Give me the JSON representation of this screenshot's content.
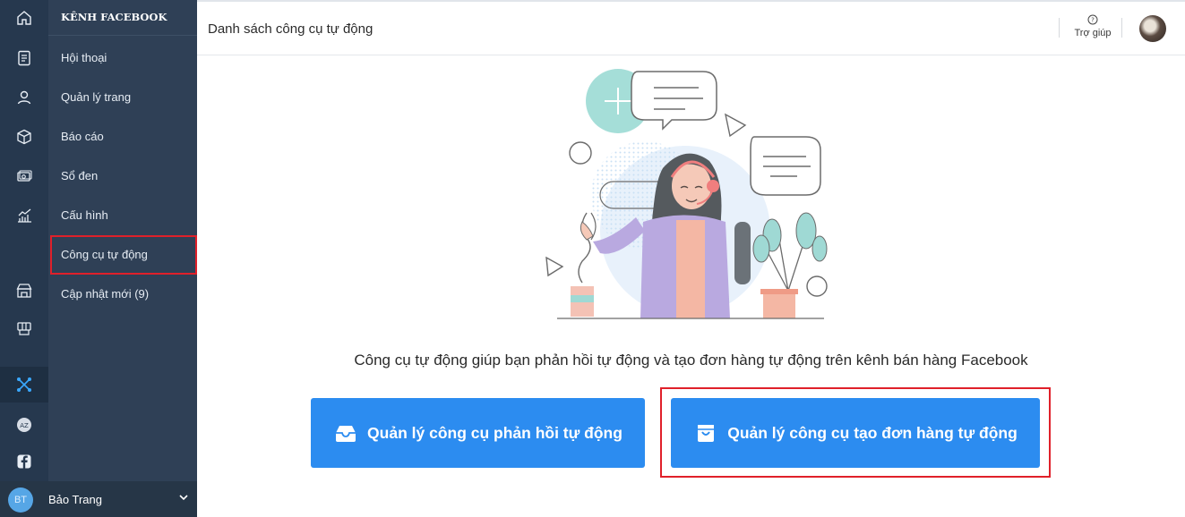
{
  "rail": {
    "icons": [
      "home-icon",
      "document-icon",
      "user-icon",
      "box-icon",
      "cash-icon",
      "chart-icon",
      "store-icon",
      "pos-icon",
      "automation-icon",
      "az-icon",
      "facebook-icon"
    ],
    "active": "automation-icon"
  },
  "menu": {
    "heading": "KÊNH FACEBOOK",
    "items": [
      {
        "label": "Hội thoại"
      },
      {
        "label": "Quản lý trang"
      },
      {
        "label": "Báo cáo"
      },
      {
        "label": "Sổ đen"
      },
      {
        "label": "Cấu hình"
      },
      {
        "label": "Công cụ tự động"
      },
      {
        "label": "Cập nhật mới (9)"
      }
    ],
    "active_item": "Công cụ tự động"
  },
  "user": {
    "initials": "BT",
    "name": "Bảo Trang"
  },
  "header": {
    "title": "Danh sách công cụ tự động",
    "help_label": "Trợ giúp"
  },
  "main": {
    "description": "Công cụ tự động giúp bạn phản hồi tự động và tạo đơn hàng tự động trên kênh bán hàng Facebook",
    "button_reply": "Quản lý công cụ phản hồi tự động",
    "button_order": "Quản lý công cụ tạo đơn hàng tự động"
  },
  "colors": {
    "rail": "#26384e",
    "menu": "#2f4056",
    "accent": "#2c8cf0",
    "highlight": "#e0202a"
  }
}
